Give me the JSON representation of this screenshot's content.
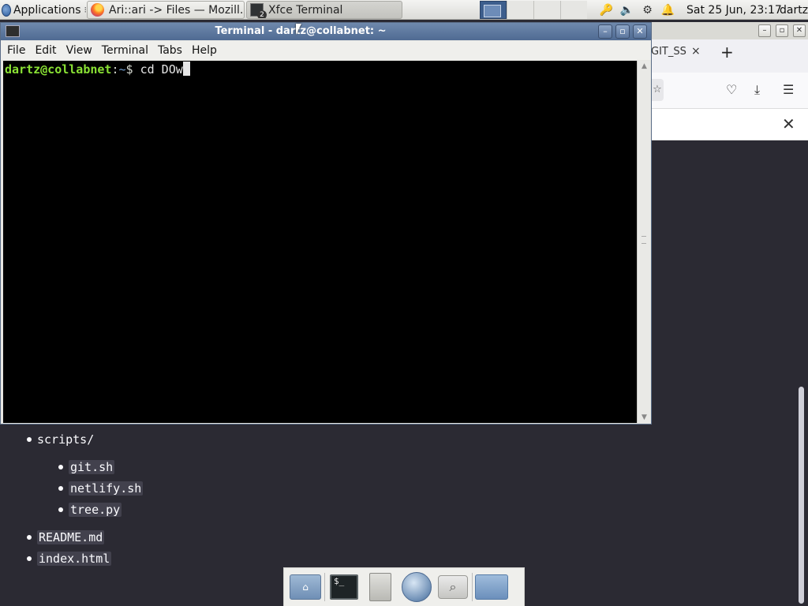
{
  "panel": {
    "applications_label": "Applications",
    "applications_sep": "⁝",
    "tasks": [
      {
        "label": "Ari::ari -> Files — Mozill...",
        "icon": "firefox-icon"
      },
      {
        "label": "Xfce Terminal",
        "icon": "terminal-icon",
        "badge": "2"
      }
    ],
    "clock": "Sat 25 Jun, 23:17",
    "user": "dartz"
  },
  "terminal": {
    "title": "Terminal - dartz@collabnet: ~",
    "menu": [
      "File",
      "Edit",
      "View",
      "Terminal",
      "Tabs",
      "Help"
    ],
    "prompt_user": "dartz@collabnet",
    "prompt_sep": ":",
    "prompt_path": "~",
    "prompt_symbol": "$",
    "command": "cd DOw"
  },
  "firefox": {
    "tab_label": "GIT_SS",
    "tab_close": "×",
    "new_tab": "+"
  },
  "page_list": {
    "items": [
      {
        "text": "scripts/",
        "level": 0
      },
      {
        "text": "git.sh",
        "level": 1
      },
      {
        "text": "netlify.sh",
        "level": 1
      },
      {
        "text": "tree.py",
        "level": 1
      },
      {
        "text": "README.md",
        "level": 0
      },
      {
        "text": "index.html",
        "level": 0
      }
    ]
  },
  "dock": {
    "items": [
      "home-folder-icon",
      "terminal-icon",
      "file-cabinet-icon",
      "web-browser-icon",
      "search-icon",
      "folder-icon"
    ]
  },
  "colors": {
    "title_bar": "#5b769d",
    "prompt_user": "#8ae234",
    "prompt_path": "#729fcf",
    "page_bg": "#2b2a33"
  }
}
